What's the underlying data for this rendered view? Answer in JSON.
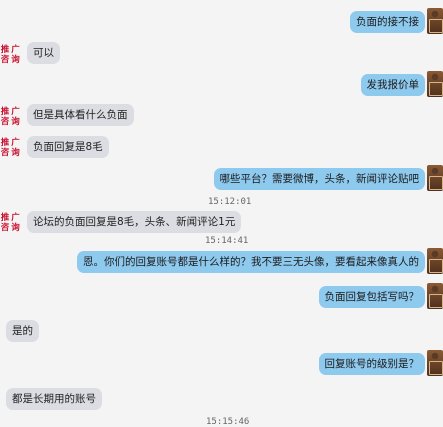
{
  "avatars": {
    "promo_line1": "推 广",
    "promo_line2": "咨 询"
  },
  "messages": [
    {
      "side": "right",
      "text": "负面的接不接"
    },
    {
      "side": "left",
      "text": "可以"
    },
    {
      "side": "right",
      "text": "发我报价单"
    },
    {
      "side": "left",
      "text": "但是具体看什么负面"
    },
    {
      "side": "left",
      "text": "负面回复是8毛"
    },
    {
      "side": "right",
      "text": "哪些平台？需要微博，头条，新闻评论贴吧"
    },
    {
      "side": "left",
      "text": "论坛的负面回复是8毛，头条、新闻评论1元"
    },
    {
      "side": "right",
      "text": "恩。你们的回复账号都是什么样的？我不要三无头像，要看起来像真人的"
    },
    {
      "side": "right",
      "text": "负面回复包括写吗？"
    },
    {
      "side": "left",
      "text": "是的"
    },
    {
      "side": "right",
      "text": "回复账号的级别是？"
    },
    {
      "side": "left",
      "text": "都是长期用的账号"
    }
  ],
  "timestamps": [
    "15:12:01",
    "15:14:41",
    "15:15:46"
  ]
}
